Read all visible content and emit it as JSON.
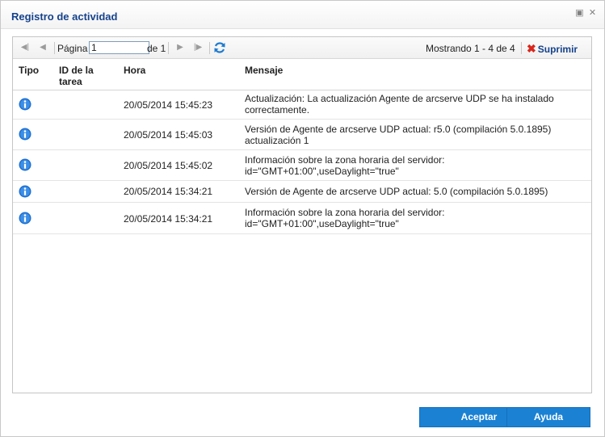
{
  "dialog": {
    "title": "Registro de actividad",
    "buttons": {
      "ok_label": "Aceptar",
      "help_label": "Ayuda"
    }
  },
  "toolbar": {
    "page_label": "Página",
    "page_value": "1",
    "page_of": "de 1",
    "showing": "Mostrando 1 - 4 de 4",
    "delete_label": "Suprimir"
  },
  "table": {
    "columns": {
      "type": "Tipo",
      "job_id_line1": "ID de la",
      "job_id_line2": "tarea",
      "time": "Hora",
      "message": "Mensaje"
    },
    "rows": [
      {
        "icon": "info-icon",
        "time": "20/05/2014 15:45:23",
        "msg1": "Actualización: La actualización Agente de arcserve UDP se ha instalado",
        "msg2": "correctamente."
      },
      {
        "icon": "info-icon",
        "time": "20/05/2014 15:45:03",
        "msg1": "Versión de Agente de arcserve UDP actual: r5.0 (compilación 5.0.1895)",
        "msg2": "actualización 1"
      },
      {
        "icon": "info-icon",
        "time": "20/05/2014 15:45:02",
        "msg1": "Información sobre la zona horaria del servidor:",
        "msg2": "id=\"GMT+01:00\",useDaylight=\"true\""
      },
      {
        "icon": "info-icon",
        "time": "20/05/2014 15:34:21",
        "msg1": "Versión de Agente de arcserve UDP actual: 5.0 (compilación 5.0.1895)",
        "msg2": ""
      },
      {
        "icon": "info-icon",
        "time": "20/05/2014 15:34:21",
        "msg1": "Información sobre la zona horaria del servidor:",
        "msg2": "id=\"GMT+01:00\",useDaylight=\"true\""
      }
    ]
  },
  "colors": {
    "title": "#15428b",
    "button": "#1b81d3",
    "delete_x": "#d9261c",
    "info_icon": "#1f6fd0"
  }
}
